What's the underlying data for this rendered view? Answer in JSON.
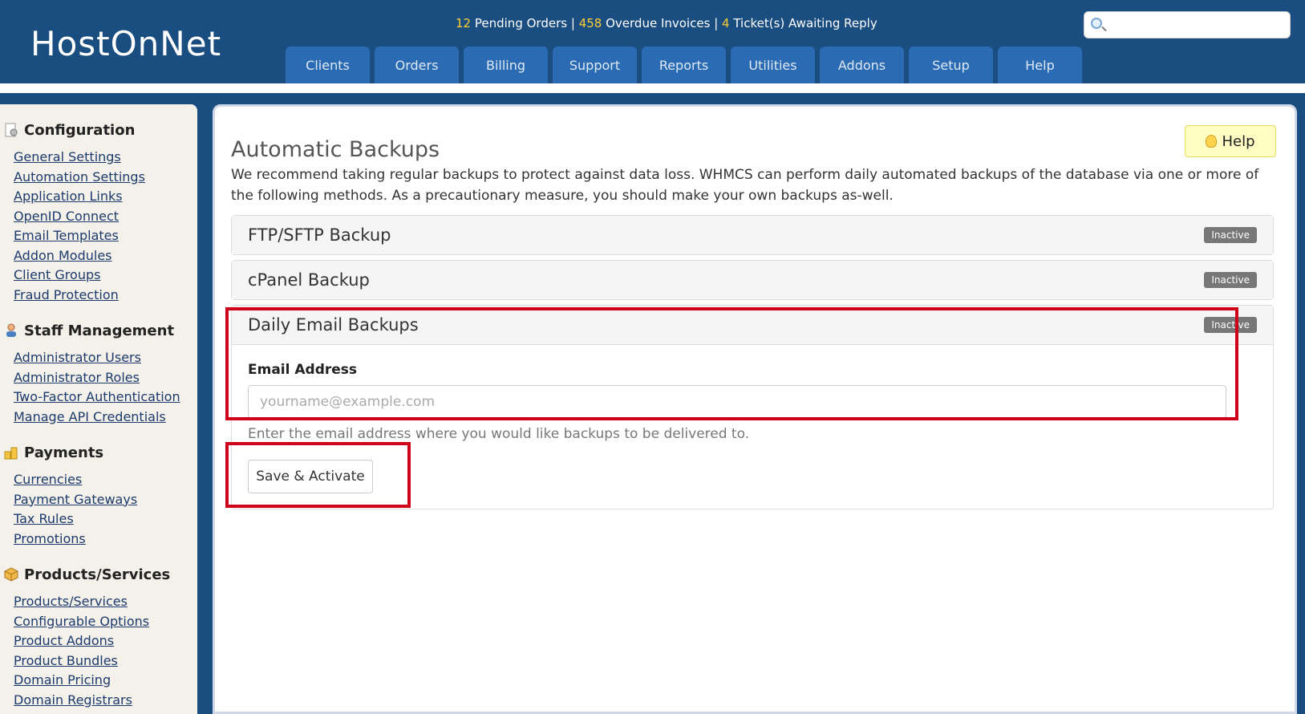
{
  "header": {
    "logo": "HostOnNet",
    "stats": {
      "pending_orders_count": "12",
      "pending_orders_label": "Pending Orders",
      "overdue_count": "458",
      "overdue_label": "Overdue Invoices",
      "tickets_count": "4",
      "tickets_label": "Ticket(s) Awaiting Reply",
      "separator": "|"
    },
    "search_placeholder": ""
  },
  "nav": [
    {
      "label": "Clients"
    },
    {
      "label": "Orders"
    },
    {
      "label": "Billing"
    },
    {
      "label": "Support"
    },
    {
      "label": "Reports"
    },
    {
      "label": "Utilities"
    },
    {
      "label": "Addons"
    },
    {
      "label": "Setup"
    },
    {
      "label": "Help"
    }
  ],
  "sidebar": {
    "sections": [
      {
        "title": "Configuration",
        "icon": "config-icon",
        "items": [
          "General Settings",
          "Automation Settings",
          "Application Links",
          "OpenID Connect",
          "Email Templates",
          "Addon Modules",
          "Client Groups",
          "Fraud Protection"
        ]
      },
      {
        "title": "Staff Management",
        "icon": "staff-icon",
        "items": [
          "Administrator Users",
          "Administrator Roles",
          "Two-Factor Authentication",
          "Manage API Credentials"
        ]
      },
      {
        "title": "Payments",
        "icon": "payments-icon",
        "items": [
          "Currencies",
          "Payment Gateways",
          "Tax Rules",
          "Promotions"
        ]
      },
      {
        "title": "Products/Services",
        "icon": "products-icon",
        "items": [
          "Products/Services",
          "Configurable Options",
          "Product Addons",
          "Product Bundles",
          "Domain Pricing",
          "Domain Registrars"
        ]
      }
    ]
  },
  "main": {
    "title": "Automatic Backups",
    "help_label": "Help",
    "intro": "We recommend taking regular backups to protect against data loss. WHMCS can perform daily automated backups of the database via one or more of the following methods. As a precautionary measure, you should make your own backups as-well.",
    "panels": {
      "ftp": {
        "title": "FTP/SFTP Backup",
        "status": "Inactive"
      },
      "cpanel": {
        "title": "cPanel Backup",
        "status": "Inactive"
      },
      "email": {
        "title": "Daily Email Backups",
        "status": "Inactive",
        "field_label": "Email Address",
        "placeholder": "yourname@example.com",
        "value": "",
        "help": "Enter the email address where you would like backups to be delivered to.",
        "button": "Save & Activate"
      }
    }
  },
  "colors": {
    "header_bg": "#1a4d80",
    "nav_tab": "#2a6bb3",
    "stat_number": "#ffcc33",
    "highlight": "#d0021b",
    "badge": "#777777"
  }
}
